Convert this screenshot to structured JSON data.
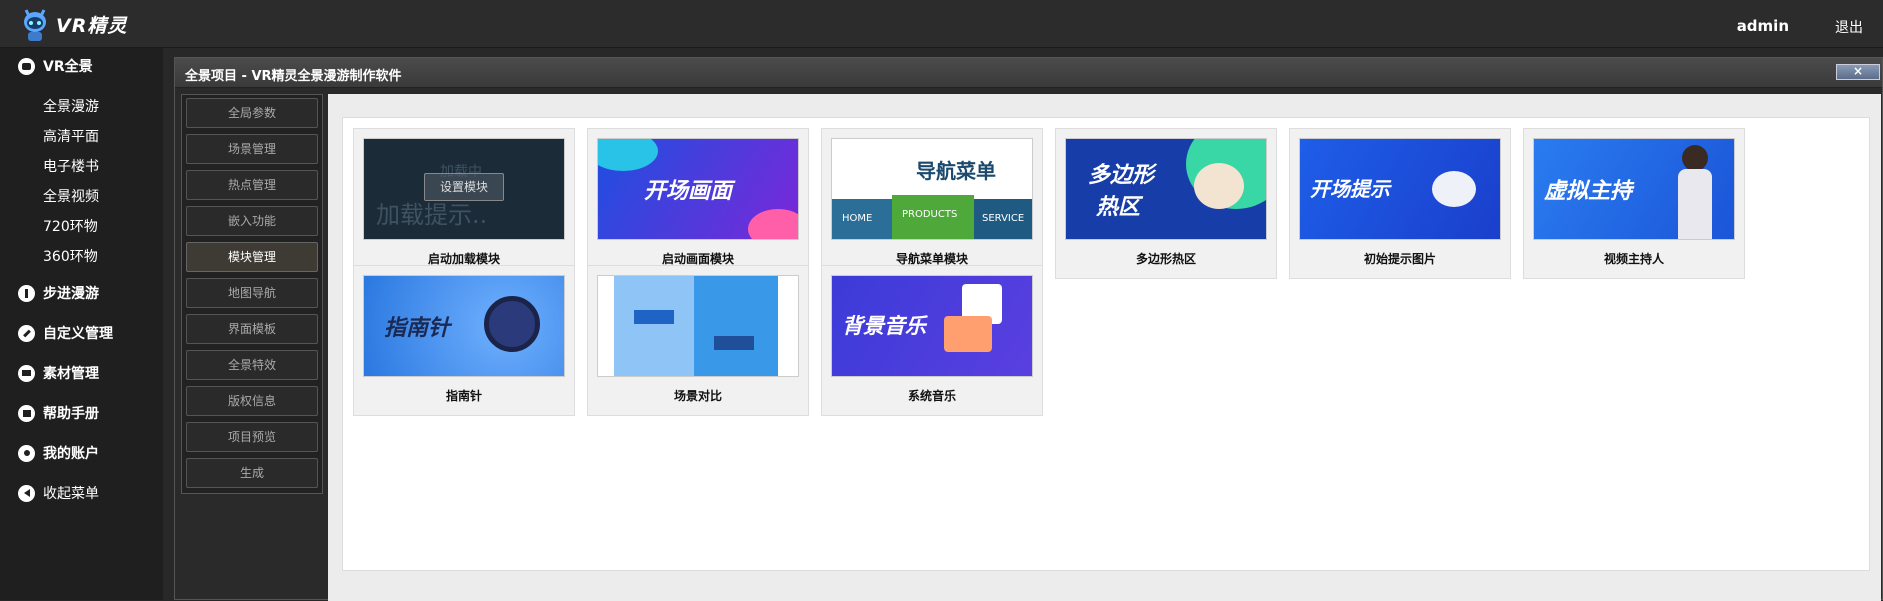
{
  "app": {
    "logo_text": "VR精灵",
    "user": "admin",
    "logout": "退出"
  },
  "sidebar": {
    "groups": [
      {
        "label": "VR全景",
        "icon": "camera-icon",
        "items": [
          "全景漫游",
          "高清平面",
          "电子楼书",
          "全景视频",
          "720环物",
          "360环物"
        ]
      },
      {
        "label": "步进漫游",
        "icon": "walk-icon"
      },
      {
        "label": "自定义管理",
        "icon": "edit-icon"
      },
      {
        "label": "素材管理",
        "icon": "folder-icon"
      },
      {
        "label": "帮助手册",
        "icon": "book-icon"
      },
      {
        "label": "我的账户",
        "icon": "user-icon"
      },
      {
        "label": "收起菜单",
        "icon": "collapse-icon"
      }
    ]
  },
  "window": {
    "title": "全景项目 - VR精灵全景漫游制作软件",
    "close": "×"
  },
  "menu": {
    "items": [
      "全局参数",
      "场景管理",
      "热点管理",
      "嵌入功能",
      "模块管理",
      "地图导航",
      "界面模板",
      "全景特效",
      "版权信息",
      "项目预览",
      "生成"
    ],
    "active_index": 4
  },
  "modules": [
    {
      "label": "启动加载模块",
      "thumb": {
        "big_text": "加载提示..",
        "small_text": "加载中",
        "button": "设置模块"
      }
    },
    {
      "label": "启动画面模块",
      "thumb": {
        "text": "开场画面"
      }
    },
    {
      "label": "导航菜单模块",
      "thumb": {
        "text": "导航菜单",
        "tabs": [
          "HOME",
          "PRODUCTS",
          "SERVICE"
        ]
      }
    },
    {
      "label": "多边形热区",
      "thumb": {
        "text_line1": "多边形",
        "text_line2": "热区"
      }
    },
    {
      "label": "初始提示图片",
      "thumb": {
        "text": "开场提示"
      }
    },
    {
      "label": "视频主持人",
      "thumb": {
        "text": "虚拟主持"
      }
    },
    {
      "label": "指南针",
      "thumb": {
        "text": "指南针"
      }
    },
    {
      "label": "场景对比",
      "thumb": {}
    },
    {
      "label": "系统音乐",
      "thumb": {
        "text": "背景音乐"
      }
    }
  ],
  "colors": {
    "topbar": "#2c2c2c",
    "sidebar": "#1f1f1f",
    "accent_blue": "#1e4fe0"
  }
}
